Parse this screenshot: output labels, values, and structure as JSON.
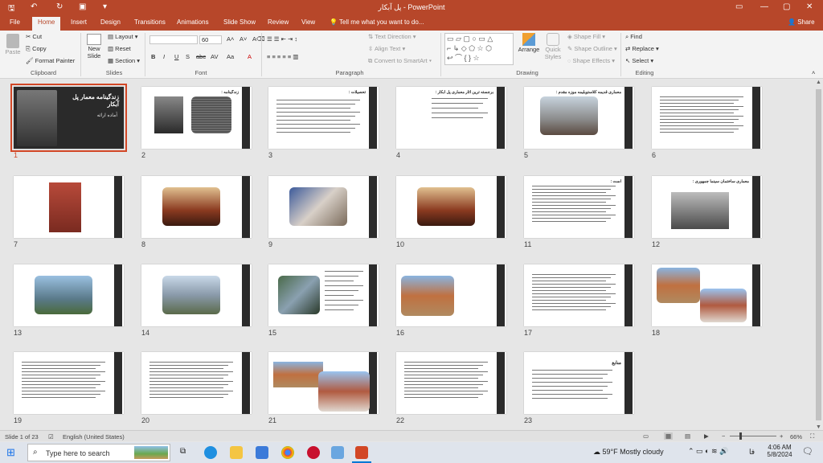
{
  "titlebar": {
    "doc_title": "پل آبکار",
    "app": " - PowerPoint",
    "save_icon": "save-icon",
    "undo_icon": "undo-icon",
    "redo_icon": "redo-icon"
  },
  "tabs": [
    "File",
    "Home",
    "Insert",
    "Design",
    "Transitions",
    "Animations",
    "Slide Show",
    "Review",
    "View"
  ],
  "tell_me": "Tell me what you want to do...",
  "share": "Share",
  "ribbon": {
    "clipboard": {
      "paste": "Paste",
      "cut": "Cut",
      "copy": "Copy",
      "format_painter": "Format Painter",
      "label": "Clipboard"
    },
    "slides": {
      "new_slide": "New Slide",
      "layout": "Layout",
      "reset": "Reset",
      "section": "Section",
      "label": "Slides"
    },
    "font": {
      "size": "60",
      "label": "Font",
      "buttons": [
        "B",
        "I",
        "U",
        "S",
        "abc",
        "AV",
        "Aa",
        "A"
      ]
    },
    "paragraph": {
      "text_direction": "Text Direction",
      "align_text": "Align Text",
      "smartart": "Convert to SmartArt",
      "label": "Paragraph"
    },
    "drawing": {
      "arrange": "Arrange",
      "quick_styles": "Quick Styles",
      "shape_fill": "Shape Fill",
      "shape_outline": "Shape Outline",
      "shape_effects": "Shape Effects",
      "label": "Drawing"
    },
    "editing": {
      "find": "Find",
      "replace": "Replace",
      "select": "Select",
      "label": "Editing"
    }
  },
  "slides": [
    {
      "n": "1",
      "title": "زندگینامه معمار پل آبکار",
      "sub": "آماده ارائه"
    },
    {
      "n": "2",
      "title": "زندگینامه :"
    },
    {
      "n": "3",
      "title": "تحصیلات :"
    },
    {
      "n": "4",
      "title": "برجسته ترین آثار معماری پل آبکار :"
    },
    {
      "n": "5",
      "title": "معماری قدیمه کلاستوبلیمه موزه مقدم :"
    },
    {
      "n": "6"
    },
    {
      "n": "7"
    },
    {
      "n": "8"
    },
    {
      "n": "9"
    },
    {
      "n": "10"
    },
    {
      "n": "11",
      "title": "است :"
    },
    {
      "n": "12",
      "title": "معماری ساختمان سینما جمهوری :"
    },
    {
      "n": "13"
    },
    {
      "n": "14"
    },
    {
      "n": "15"
    },
    {
      "n": "16"
    },
    {
      "n": "17"
    },
    {
      "n": "18"
    },
    {
      "n": "19"
    },
    {
      "n": "20"
    },
    {
      "n": "21"
    },
    {
      "n": "22"
    },
    {
      "n": "23",
      "title": "منابع"
    }
  ],
  "status": {
    "slide_count": "Slide 1 of 23",
    "language": "English (United States)",
    "zoom": "66%"
  },
  "taskbar": {
    "search": "Type here to search",
    "weather": "59°F  Mostly cloudy",
    "time": "4:06 AM",
    "date": "5/8/2024",
    "lang": "فا"
  }
}
